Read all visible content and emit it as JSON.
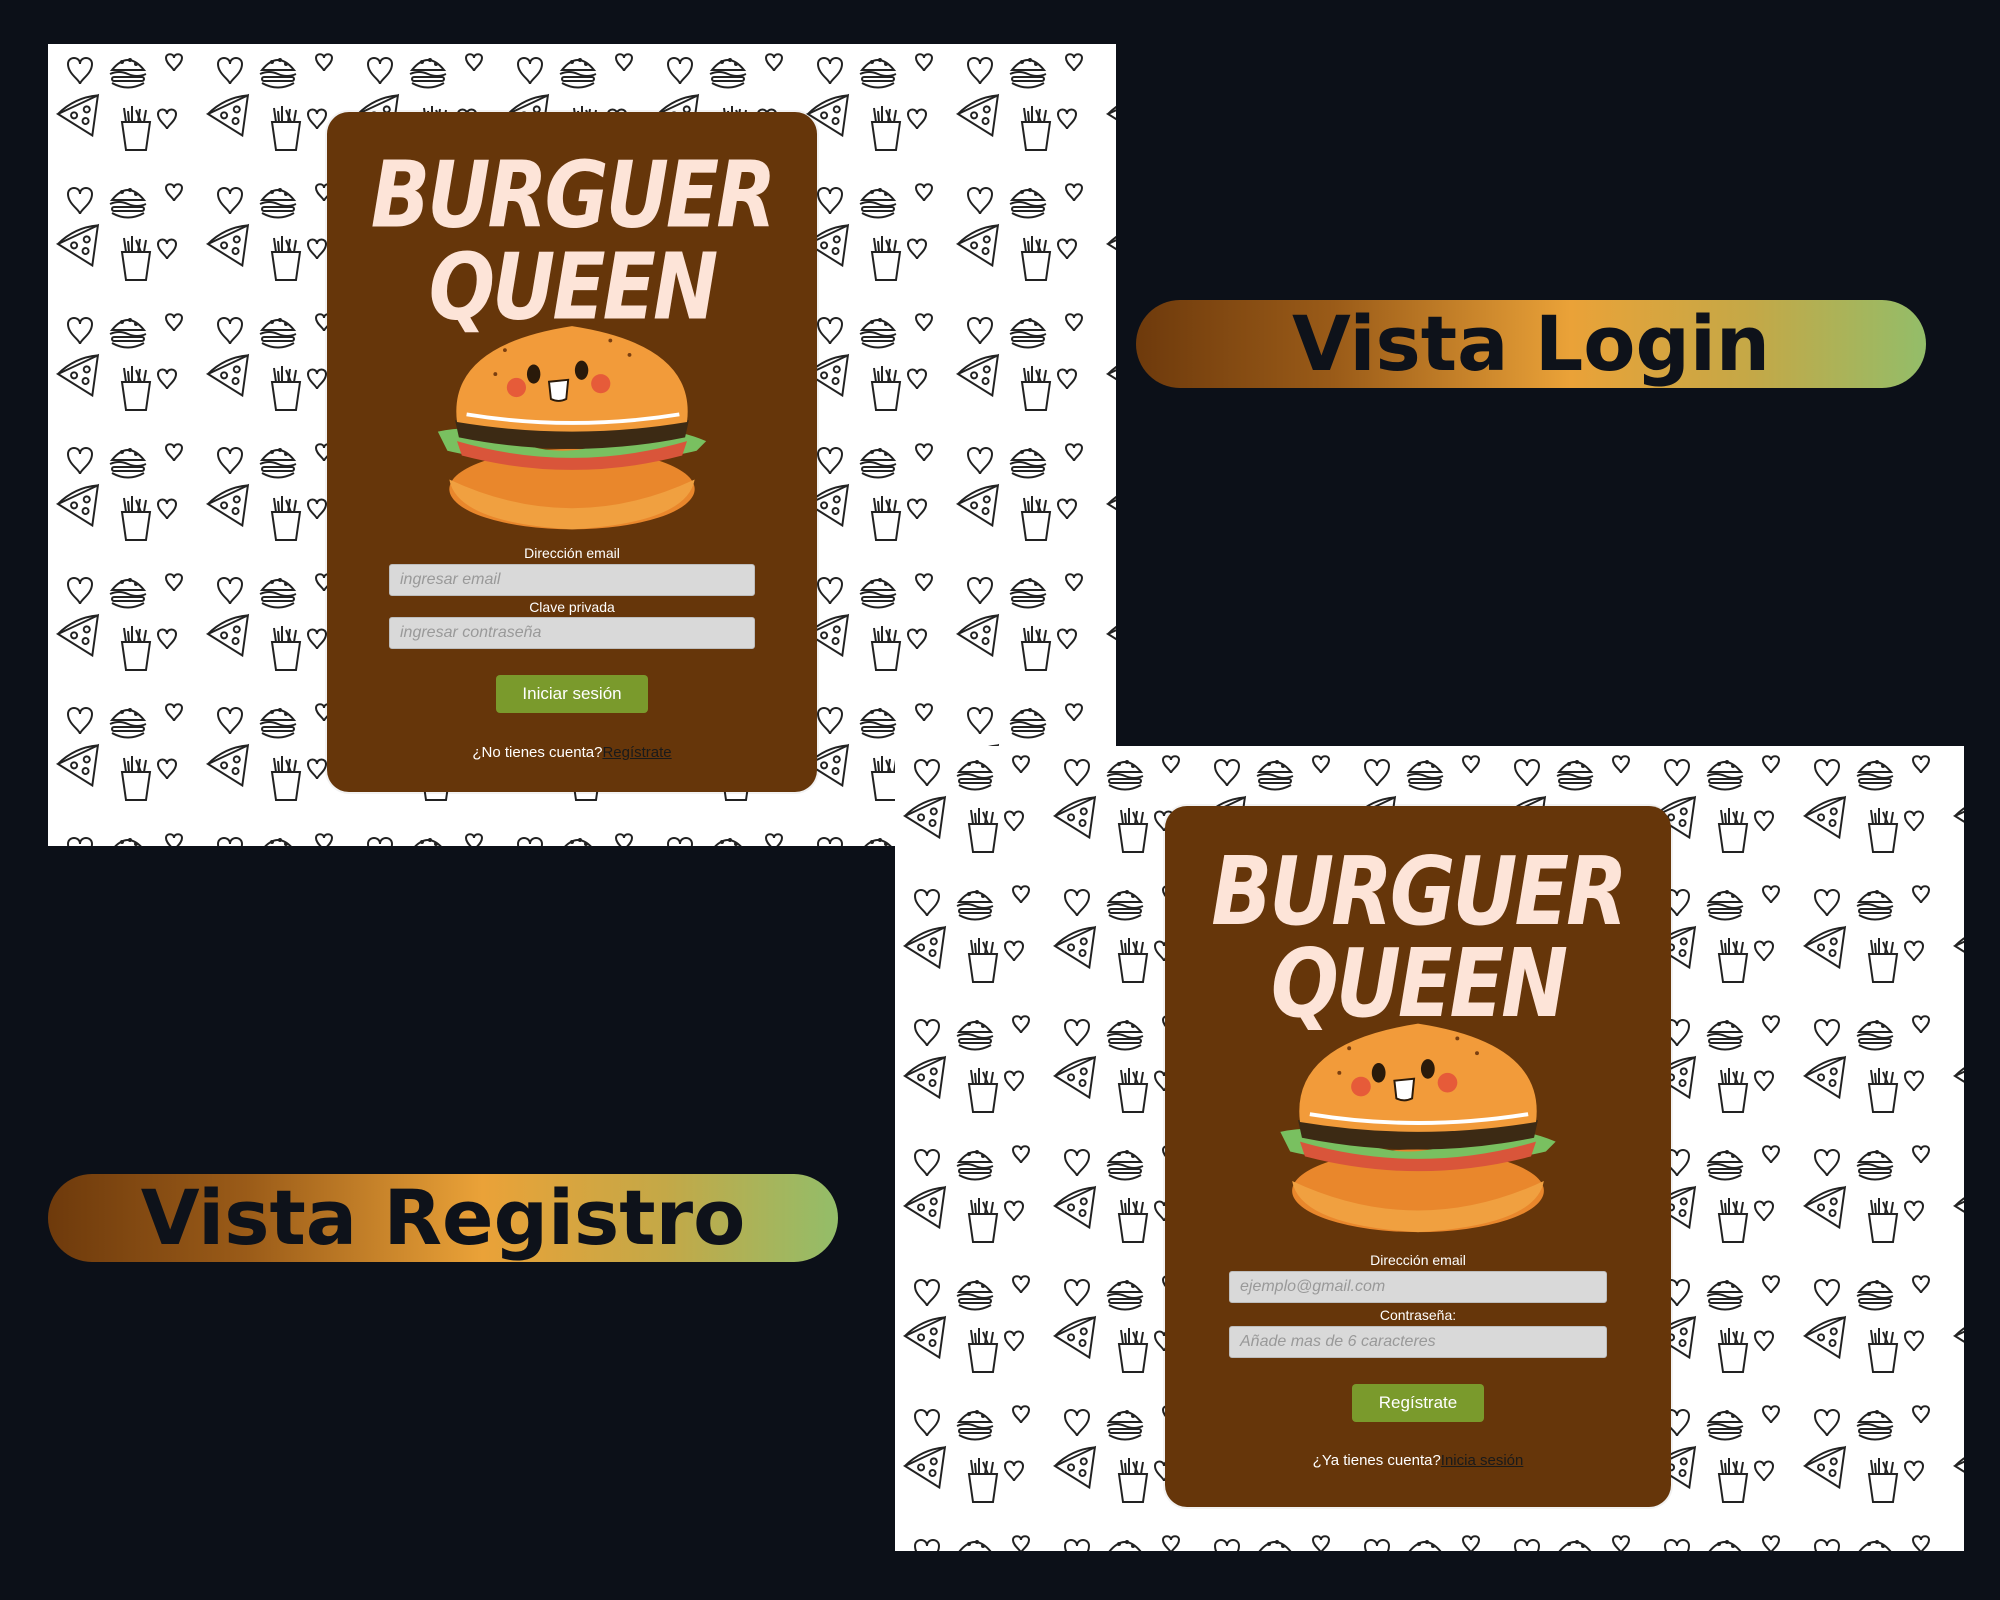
{
  "labels": {
    "login_view": "Vista Login",
    "register_view": "Vista Registro"
  },
  "login": {
    "logo_line1": "BURGUER",
    "logo_line2": "QUEEN",
    "email_label": "Dirección email",
    "email_placeholder": "ingresar email",
    "password_label": "Clave privada",
    "password_placeholder": "ingresar contraseña",
    "submit_label": "Iniciar sesión",
    "footer_text": "¿No tienes cuenta?",
    "footer_link": "Regístrate"
  },
  "register": {
    "logo_line1": "BURGUER",
    "logo_line2": "QUEEN",
    "email_label": "Dirección email",
    "email_placeholder": "ejemplo@gmail.com",
    "password_label": "Contraseña:",
    "password_placeholder": "Añade mas de 6 caracteres",
    "submit_label": "Regístrate",
    "footer_text": "¿Ya tienes cuenta?",
    "footer_link": "Inicia sesión"
  },
  "colors": {
    "page_bg": "#0c1018",
    "card_bg": "#66360a",
    "logo_text": "#fde4d8",
    "button_bg": "#7a9a2c",
    "input_bg": "#d9d9d9",
    "pill_gradient": [
      "#6e3a0c",
      "#eaa238",
      "#93bd69"
    ]
  },
  "icons": {
    "pattern_items": [
      "heart-icon",
      "burger-icon",
      "pizza-icon",
      "fries-icon"
    ],
    "mascot": "burger-mascot-icon"
  }
}
